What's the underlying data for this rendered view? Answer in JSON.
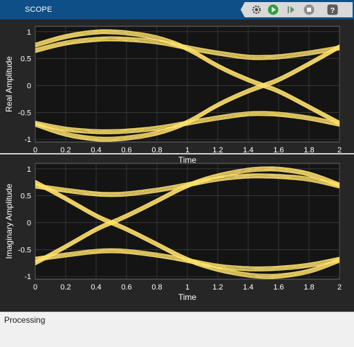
{
  "app": {
    "title": "SCOPE"
  },
  "toolbar": {
    "buttons": [
      {
        "name": "settings-button",
        "icon": "gear-icon"
      },
      {
        "name": "run-button",
        "icon": "play-icon"
      },
      {
        "name": "step-forward-button",
        "icon": "step-forward-icon"
      },
      {
        "name": "stop-button",
        "icon": "stop-icon"
      },
      {
        "name": "help-button",
        "icon": "help-icon"
      }
    ]
  },
  "status": {
    "text": "Processing"
  },
  "colors": {
    "trace": "#ffe26b",
    "plot_bg": "#141414",
    "grid": "#4a4a4a",
    "header": "#0f4f87"
  },
  "chart_data": [
    {
      "type": "line",
      "title": "",
      "xlabel": "Time",
      "ylabel": "Real Amplitude",
      "xlim": [
        0,
        2
      ],
      "ylim": [
        -1.05,
        1.1
      ],
      "x_ticks": [
        "0",
        "0.2",
        "0.4",
        "0.6",
        "0.8",
        "1",
        "1.2",
        "1.4",
        "1.6",
        "1.8",
        "2"
      ],
      "y_ticks": [
        "1",
        "0.5",
        "0",
        "-0.5",
        "-1"
      ],
      "grid": true,
      "x": [
        0,
        0.2,
        0.4,
        0.5,
        0.6,
        0.8,
        1.0,
        1.2,
        1.4,
        1.5,
        1.6,
        1.8,
        2.0
      ],
      "series": [
        {
          "values": [
            0.75,
            0.92,
            1.0,
            1.0,
            0.98,
            0.9,
            0.7,
            0.35,
            0.1,
            0.0,
            -0.1,
            -0.4,
            -0.7
          ]
        },
        {
          "values": [
            0.65,
            0.8,
            0.86,
            0.87,
            0.86,
            0.82,
            0.7,
            0.6,
            0.52,
            0.52,
            0.53,
            0.6,
            0.7
          ]
        },
        {
          "values": [
            -0.7,
            -0.82,
            -0.86,
            -0.86,
            -0.85,
            -0.8,
            -0.7,
            -0.6,
            -0.52,
            -0.52,
            -0.53,
            -0.6,
            -0.72
          ]
        },
        {
          "values": [
            -0.72,
            -0.92,
            -1.0,
            -1.0,
            -0.98,
            -0.9,
            -0.7,
            -0.35,
            -0.1,
            0.0,
            0.1,
            0.4,
            0.72
          ]
        }
      ]
    },
    {
      "type": "line",
      "title": "",
      "xlabel": "Time",
      "ylabel": "Imaginary Amplitude",
      "xlim": [
        0,
        2
      ],
      "ylim": [
        -1.05,
        1.1
      ],
      "x_ticks": [
        "0",
        "0.2",
        "0.4",
        "0.6",
        "0.8",
        "1",
        "1.2",
        "1.4",
        "1.6",
        "1.8",
        "2"
      ],
      "y_ticks": [
        "1",
        "0.5",
        "0",
        "-0.5",
        "-1"
      ],
      "grid": true,
      "x": [
        0,
        0.2,
        0.4,
        0.5,
        0.6,
        0.8,
        1.0,
        1.2,
        1.4,
        1.5,
        1.6,
        1.8,
        2.0
      ],
      "series": [
        {
          "values": [
            0.75,
            0.45,
            0.12,
            0.0,
            -0.12,
            -0.4,
            -0.7,
            -0.88,
            -0.98,
            -1.0,
            -1.0,
            -0.92,
            -0.7
          ]
        },
        {
          "values": [
            0.68,
            0.6,
            0.53,
            0.52,
            0.53,
            0.6,
            0.7,
            0.82,
            0.87,
            0.87,
            0.86,
            0.82,
            0.68
          ]
        },
        {
          "values": [
            -0.68,
            -0.6,
            -0.53,
            -0.52,
            -0.53,
            -0.6,
            -0.7,
            -0.82,
            -0.86,
            -0.86,
            -0.85,
            -0.8,
            -0.68
          ]
        },
        {
          "values": [
            -0.75,
            -0.45,
            -0.12,
            0.0,
            0.12,
            0.4,
            0.7,
            0.88,
            0.98,
            1.0,
            1.0,
            0.92,
            0.7
          ]
        }
      ]
    }
  ]
}
